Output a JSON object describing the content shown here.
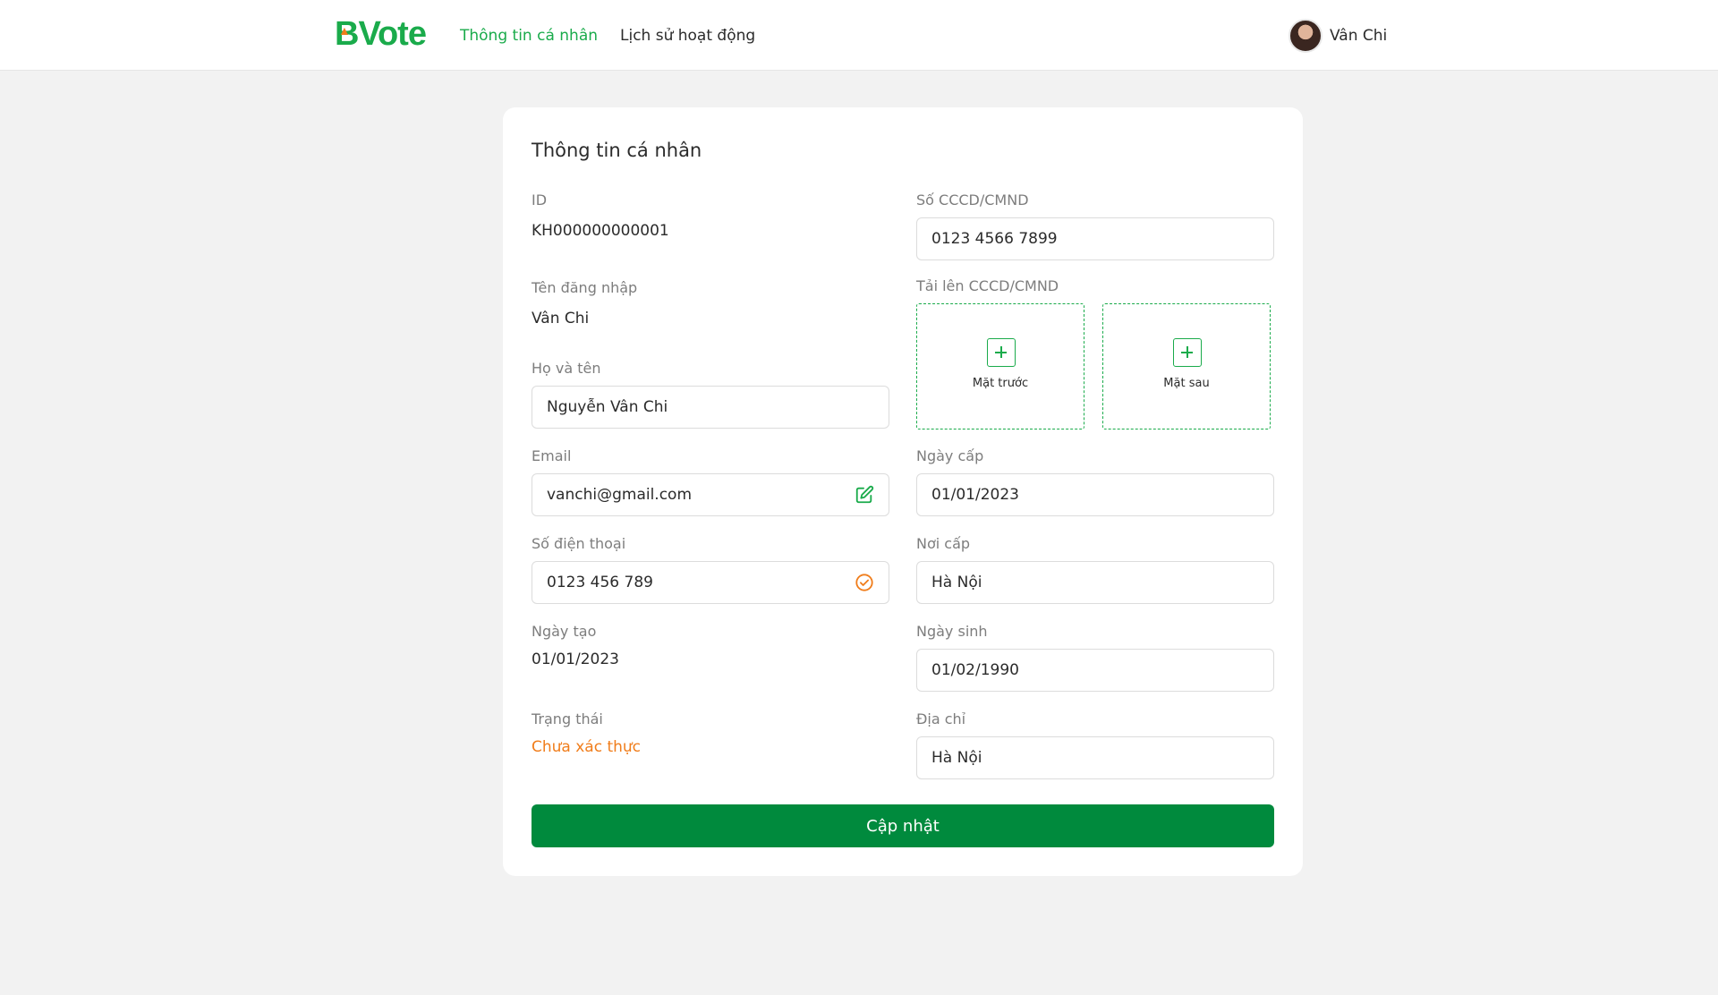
{
  "header": {
    "logo": "BVote",
    "nav": [
      {
        "label": "Thông tin cá nhân",
        "active": true
      },
      {
        "label": "Lịch sử hoạt động",
        "active": false
      }
    ],
    "user_name": "Vân Chi"
  },
  "colors": {
    "brand": "#1aab4b",
    "brand_dark": "#008a3d",
    "warning": "#f07d1b",
    "background": "#f2f2f2"
  },
  "form": {
    "title": "Thông tin cá nhân",
    "id": {
      "label": "ID",
      "value": "KH000000000001"
    },
    "username": {
      "label": "Tên đăng nhập",
      "value": "Vân Chi"
    },
    "full_name": {
      "label": "Họ và tên",
      "value": "Nguyễn Vân Chi"
    },
    "email": {
      "label": "Email",
      "value": "vanchi@gmail.com",
      "icon": "edit-icon"
    },
    "phone": {
      "label": "Số điện thoại",
      "value": "0123 456 789",
      "icon": "verified-check-icon"
    },
    "created_date": {
      "label": "Ngày tạo",
      "value": "01/01/2023"
    },
    "status": {
      "label": "Trạng thái",
      "value": "Chưa xác thực"
    },
    "id_number": {
      "label": "Số CCCD/CMND",
      "value": "0123 4566 7899"
    },
    "id_upload": {
      "label": "Tải lên CCCD/CMND",
      "front_label": "Mặt trước",
      "back_label": "Mặt sau",
      "icon": "plus-icon"
    },
    "issue_date": {
      "label": "Ngày cấp",
      "value": "01/01/2023"
    },
    "issue_place": {
      "label": "Nơi cấp",
      "value": "Hà Nội"
    },
    "birth_date": {
      "label": "Ngày sinh",
      "value": "01/02/1990"
    },
    "address": {
      "label": "Địa chỉ",
      "value": "Hà Nội"
    },
    "submit_label": "Cập nhật"
  }
}
